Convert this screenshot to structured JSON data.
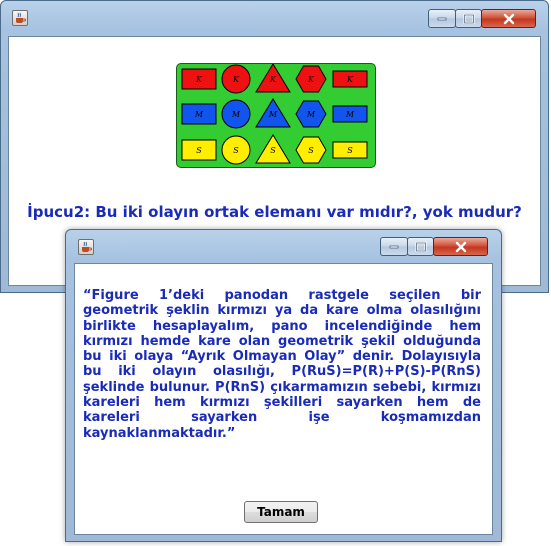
{
  "main_window": {
    "icon": "java-cup-icon",
    "controls": [
      "minimize-icon",
      "maximize-icon",
      "close-icon"
    ],
    "hint_text": "İpucu2: Bu iki olayın ortak elemanı var mıdır?, yok mudur?",
    "board": {
      "background_color": "#33cc33",
      "rows": [
        {
          "color": "#ee1111",
          "label_color": "#000000",
          "cells": [
            {
              "shape": "rectangle",
              "label": "K"
            },
            {
              "shape": "circle",
              "label": "K"
            },
            {
              "shape": "triangle",
              "label": "K"
            },
            {
              "shape": "hexagon",
              "label": "K"
            },
            {
              "shape": "square",
              "label": "K"
            }
          ]
        },
        {
          "color": "#1155ee",
          "label_color": "#000000",
          "cells": [
            {
              "shape": "rectangle",
              "label": "M"
            },
            {
              "shape": "circle",
              "label": "M"
            },
            {
              "shape": "triangle",
              "label": "M"
            },
            {
              "shape": "hexagon",
              "label": "M"
            },
            {
              "shape": "square",
              "label": "M"
            }
          ]
        },
        {
          "color": "#ffee00",
          "label_color": "#000000",
          "cells": [
            {
              "shape": "rectangle",
              "label": "S"
            },
            {
              "shape": "circle",
              "label": "S"
            },
            {
              "shape": "triangle",
              "label": "S"
            },
            {
              "shape": "hexagon",
              "label": "S"
            },
            {
              "shape": "square",
              "label": "S"
            }
          ]
        }
      ]
    }
  },
  "dialog": {
    "icon": "java-cup-icon",
    "controls": [
      "minimize-icon",
      "maximize-icon",
      "close-icon"
    ],
    "message": "“Figure 1’deki panodan rastgele seçilen bir geometrik şeklin kırmızı ya da kare olma olasılığını birlikte hesaplayalım, pano incelendiğinde hem kırmızı hemde kare olan geometrik şekil olduğunda bu iki olaya “Ayrık Olmayan Olay” denir. Dolayısıyla bu iki olayın olasılığı, P(RuS)=P(R)+P(S)-P(RnS) şeklinde bulunur. P(RnS) çıkarmamızın sebebi, kırmızı kareleri hem kırmızı şekilleri sayarken hem de kareleri sayarken işe koşmamızdan kaynaklanmaktadır.”",
    "ok_label": "Tamam"
  },
  "colors": {
    "text_blue": "#1a2bb8",
    "title_bar": "#a6c2e0",
    "close_button": "#c3371f"
  }
}
